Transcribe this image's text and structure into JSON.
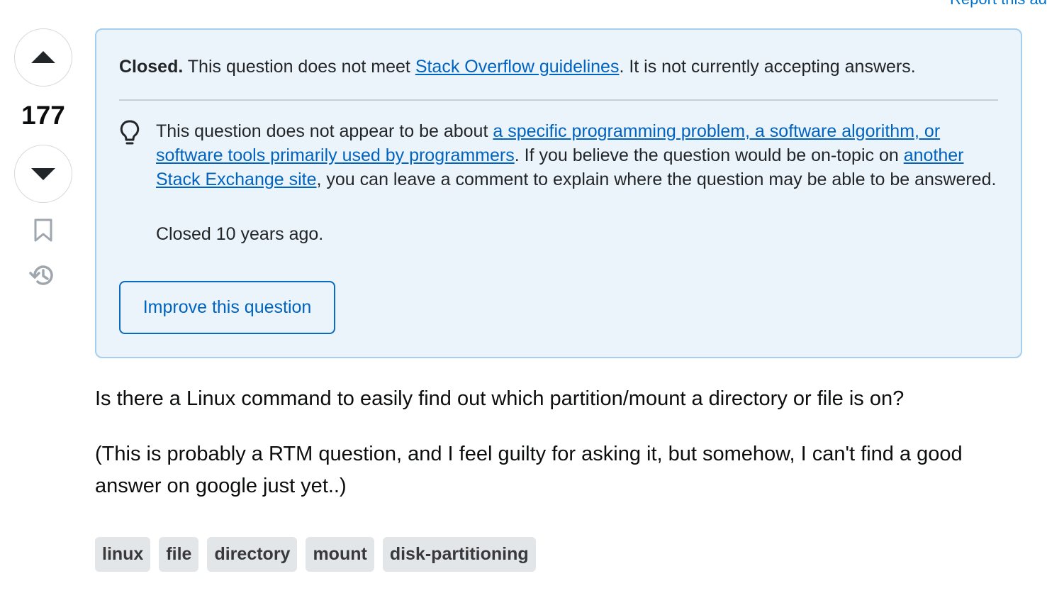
{
  "report_link": "Report this ad",
  "votes": {
    "count": "177",
    "up_icon": "caret-up-icon",
    "down_icon": "caret-down-icon",
    "bookmark_icon": "bookmark-icon",
    "history_icon": "history-icon"
  },
  "notice": {
    "head_bold": "Closed.",
    "head_text_1": " This question does not meet ",
    "head_link": "Stack Overflow guidelines",
    "head_text_2": ". It is not currently accepting answers.",
    "reason_text_1": "This question does not appear to be about ",
    "reason_link_1": "a specific programming problem, a software algorithm, or software tools primarily used by programmers",
    "reason_text_2": ". If you believe the question would be on-topic on ",
    "reason_link_2": "another Stack Exchange site",
    "reason_text_3": ", you can leave a comment to explain where the question may be able to be answered.",
    "closed_ago": "Closed 10 years ago.",
    "improve_button": "Improve this question",
    "bulb_icon": "lightbulb-icon"
  },
  "body": {
    "paragraph_1": "Is there a Linux command to easily find out which partition/mount a directory or file is on?",
    "paragraph_2": "(This is probably a RTM question, and I feel guilty for asking it, but somehow, I can't find a good answer on google just yet..)"
  },
  "tags": [
    "linux",
    "file",
    "directory",
    "mount",
    "disk-partitioning"
  ],
  "colors": {
    "link": "#0063bf",
    "notice_bg": "#ebf4fb",
    "notice_border": "#a6ceed",
    "tag_bg": "#e3e6e8"
  }
}
